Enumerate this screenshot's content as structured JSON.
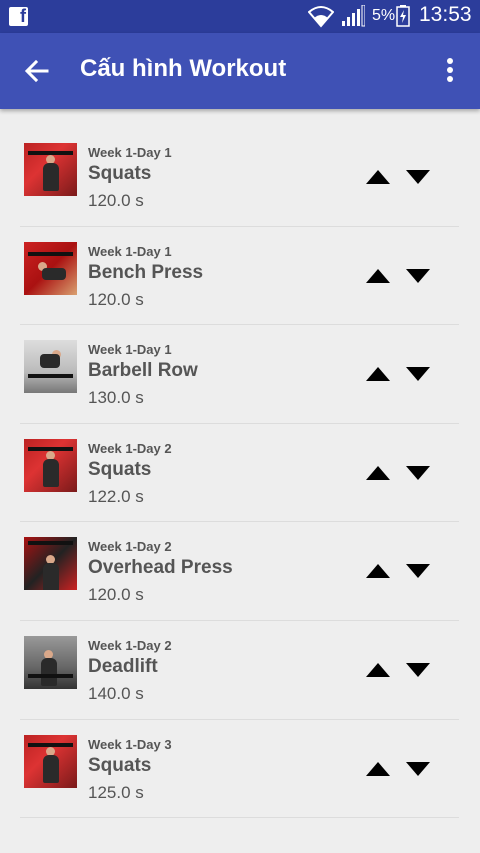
{
  "status_bar": {
    "battery": "5%",
    "time": "13:53"
  },
  "app_bar": {
    "title": "Cấu hình Workout"
  },
  "exercises": [
    {
      "day": "Week 1-Day 1",
      "name": "Squats",
      "duration": "120.0 s"
    },
    {
      "day": "Week 1-Day 1",
      "name": "Bench Press",
      "duration": "120.0 s"
    },
    {
      "day": "Week 1-Day 1",
      "name": "Barbell Row",
      "duration": "130.0 s"
    },
    {
      "day": "Week 1-Day 2",
      "name": "Squats",
      "duration": "122.0 s"
    },
    {
      "day": "Week 1-Day 2",
      "name": "Overhead Press",
      "duration": "120.0 s"
    },
    {
      "day": "Week 1-Day 2",
      "name": "Deadlift",
      "duration": "140.0 s"
    },
    {
      "day": "Week 1-Day 3",
      "name": "Squats",
      "duration": "125.0 s"
    }
  ],
  "colors": {
    "status_bar": "#2c3d9b",
    "app_bar": "#3f51b5",
    "background": "#eeeeee",
    "text": "#555555"
  },
  "icons": [
    "facebook-icon",
    "wifi-icon",
    "signal-icon",
    "battery-icon",
    "back-arrow-icon",
    "more-vert-icon",
    "arrow-up-icon",
    "arrow-down-icon"
  ]
}
